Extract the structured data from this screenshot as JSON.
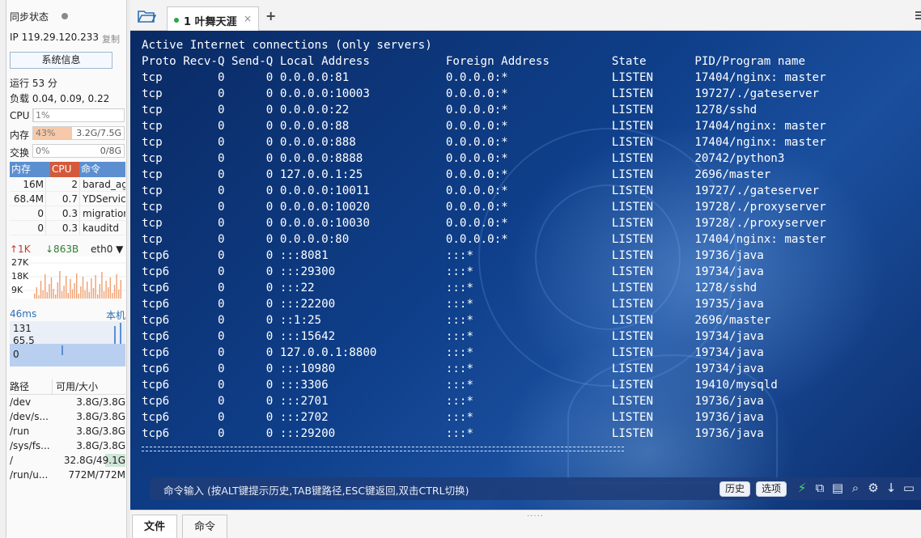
{
  "sidebar": {
    "sync_title": "同步状态",
    "ip_label": "IP 119.29.120.233",
    "copy_label": "复制",
    "sysinfo_button": "系统信息",
    "uptime": "运行 53 分",
    "load": "负载 0.04, 0.09, 0.22",
    "meters": [
      {
        "label": "CPU",
        "left": "1%",
        "right": "",
        "fill_fraction": 0.01,
        "fill_color": "#cde4c9"
      },
      {
        "label": "内存",
        "left": "43%",
        "right": "3.2G/7.5G",
        "fill_fraction": 0.43,
        "fill_color": "#f7c9a8"
      },
      {
        "label": "交换",
        "left": "0%",
        "right": "0/8G",
        "fill_fraction": 0.0,
        "fill_color": "#cde4c9"
      }
    ],
    "process_table": {
      "headers": [
        "内存",
        "CPU",
        "命令"
      ],
      "rows": [
        [
          "16M",
          "2",
          "barad_ag"
        ],
        [
          "68.4M",
          "0.7",
          "YDService"
        ],
        [
          "0",
          "0.3",
          "migration"
        ],
        [
          "0",
          "0.3",
          "kauditd"
        ]
      ]
    },
    "network": {
      "up": "↑1K",
      "down": "↓863B",
      "interface": "eth0",
      "y_ticks": [
        "27K",
        "18K",
        "9K"
      ]
    },
    "ping": {
      "ms": "46ms",
      "host": "本机",
      "y_ticks": [
        "131",
        "65.5",
        "0"
      ]
    },
    "disk_table": {
      "headers": [
        "路径",
        "可用/大小"
      ],
      "rows": [
        [
          "/dev",
          "3.8G/3.8G"
        ],
        [
          "/dev/s...",
          "3.8G/3.8G"
        ],
        [
          "/run",
          "3.8G/3.8G"
        ],
        [
          "/sys/fs...",
          "3.8G/3.8G"
        ],
        [
          "/",
          "32.8G/49.1G"
        ],
        [
          "/run/u...",
          "772M/772M"
        ]
      ]
    }
  },
  "tabs": {
    "active_tab_title": "1 叶舞天涯",
    "close_symbol": "×",
    "add_symbol": "+"
  },
  "terminal": {
    "lines": [
      "Active Internet connections (only servers)",
      "Proto Recv-Q Send-Q Local Address           Foreign Address         State       PID/Program name",
      "tcp        0      0 0.0.0.0:81              0.0.0.0:*               LISTEN      17404/nginx: master",
      "tcp        0      0 0.0.0.0:10003           0.0.0.0:*               LISTEN      19727/./gateserver",
      "tcp        0      0 0.0.0.0:22              0.0.0.0:*               LISTEN      1278/sshd",
      "tcp        0      0 0.0.0.0:88              0.0.0.0:*               LISTEN      17404/nginx: master",
      "tcp        0      0 0.0.0.0:888             0.0.0.0:*               LISTEN      17404/nginx: master",
      "tcp        0      0 0.0.0.0:8888            0.0.0.0:*               LISTEN      20742/python3",
      "tcp        0      0 127.0.0.1:25            0.0.0.0:*               LISTEN      2696/master",
      "tcp        0      0 0.0.0.0:10011           0.0.0.0:*               LISTEN      19727/./gateserver",
      "tcp        0      0 0.0.0.0:10020           0.0.0.0:*               LISTEN      19728/./proxyserver",
      "tcp        0      0 0.0.0.0:10030           0.0.0.0:*               LISTEN      19728/./proxyserver",
      "tcp        0      0 0.0.0.0:80              0.0.0.0:*               LISTEN      17404/nginx: master",
      "tcp6       0      0 :::8081                 :::*                    LISTEN      19736/java",
      "tcp6       0      0 :::29300                :::*                    LISTEN      19734/java",
      "tcp6       0      0 :::22                   :::*                    LISTEN      1278/sshd",
      "tcp6       0      0 :::22200                :::*                    LISTEN      19735/java",
      "tcp6       0      0 ::1:25                  :::*                    LISTEN      2696/master",
      "tcp6       0      0 :::15642                :::*                    LISTEN      19734/java",
      "tcp6       0      0 127.0.0.1:8800          :::*                    LISTEN      19734/java",
      "tcp6       0      0 :::10980                :::*                    LISTEN      19734/java",
      "tcp6       0      0 :::3306                 :::*                    LISTEN      19410/mysqld",
      "tcp6       0      0 :::2701                 :::*                    LISTEN      19736/java",
      "tcp6       0      0 :::2702                 :::*                    LISTEN      19736/java",
      "tcp6       0      0 :::29200                :::*                    LISTEN      19736/java"
    ]
  },
  "command_bar": {
    "hint": "命令输入 (按ALT键提示历史,TAB键路径,ESC键返回,双击CTRL切换)",
    "history_button": "历史",
    "options_button": "选项"
  },
  "bottom_tabs": {
    "files": "文件",
    "commands": "命令"
  },
  "colors": {
    "terminal_bg": "#0f3f8a",
    "accent_blue": "#5b8fd0",
    "cpu_header": "#d45a3c",
    "status_green": "#28a745"
  }
}
